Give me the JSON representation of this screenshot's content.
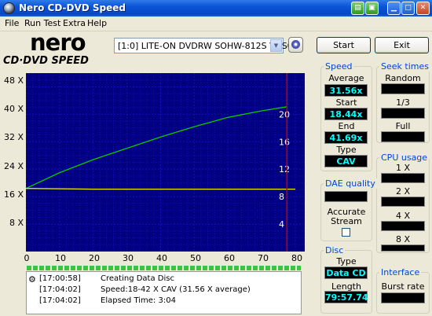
{
  "window": {
    "title": "Nero CD-DVD Speed",
    "minimize": "▁",
    "maximize": "□",
    "close": "✕"
  },
  "menu": [
    "File",
    "Run Test",
    "Extra",
    "Help"
  ],
  "logo": {
    "line1": "nero",
    "line2": "CD·DVD SPEED"
  },
  "drive_select": {
    "value": "[1:0]  LITE-ON DVDRW SOHW-812S VUS0"
  },
  "buttons": {
    "start": "Start",
    "exit": "Exit"
  },
  "chart_data": {
    "type": "line",
    "x_ticks": [
      "0",
      "10",
      "20",
      "30",
      "40",
      "50",
      "60",
      "70",
      "80"
    ],
    "y_left_ticks": [
      "8 X",
      "16 X",
      "24 X",
      "32 X",
      "40 X",
      "48 X"
    ],
    "y_right_ticks": [
      "4",
      "8",
      "12",
      "16",
      "20"
    ],
    "xlim": [
      0,
      80
    ],
    "ylim_left": [
      0,
      52
    ],
    "ylim_right": [
      0,
      26
    ],
    "series": [
      {
        "color": "#00cc00",
        "x": [
          0,
          10,
          20,
          30,
          40,
          50,
          60,
          70,
          77.5
        ],
        "y": [
          18.4,
          23.0,
          26.8,
          30.1,
          33.4,
          36.4,
          39.1,
          41.0,
          42.2
        ]
      },
      {
        "color": "#e8e800",
        "x": [
          0,
          20,
          40,
          60,
          80
        ],
        "y": [
          18.4,
          18.2,
          18.2,
          18.2,
          18.2
        ]
      }
    ],
    "marker_x": 77.5,
    "colors": {
      "bg": "#000080",
      "grid": "#0f0fc0",
      "marker": "#c00000"
    }
  },
  "log": [
    {
      "time": "[17:00:58]",
      "text": "Creating Data Disc"
    },
    {
      "time": "[17:04:02]",
      "text": "Speed:18-42 X CAV (31.56 X average)"
    },
    {
      "time": "[17:04:02]",
      "text": "Elapsed Time:   3:04"
    }
  ],
  "speed": {
    "header": "Speed",
    "average_label": "Average",
    "average": "31.56x",
    "start_label": "Start",
    "start": "18.44x",
    "end_label": "End",
    "end": "41.69x",
    "type_label": "Type",
    "type": "CAV"
  },
  "seek": {
    "header": "Seek times",
    "random": "Random",
    "third": "1/3",
    "full": "Full"
  },
  "cpu": {
    "header": "CPU usage",
    "l1": "1 X",
    "l2": "2 X",
    "l4": "4 X",
    "l8": "8 X"
  },
  "dae": {
    "header": "DAE quality",
    "accurate": "Accurate",
    "stream": "Stream"
  },
  "disc": {
    "header": "Disc",
    "type_label": "Type",
    "type": "Data CD",
    "length_label": "Length",
    "length": "79:57.74"
  },
  "interface": {
    "header": "Interface",
    "burst": "Burst rate"
  }
}
